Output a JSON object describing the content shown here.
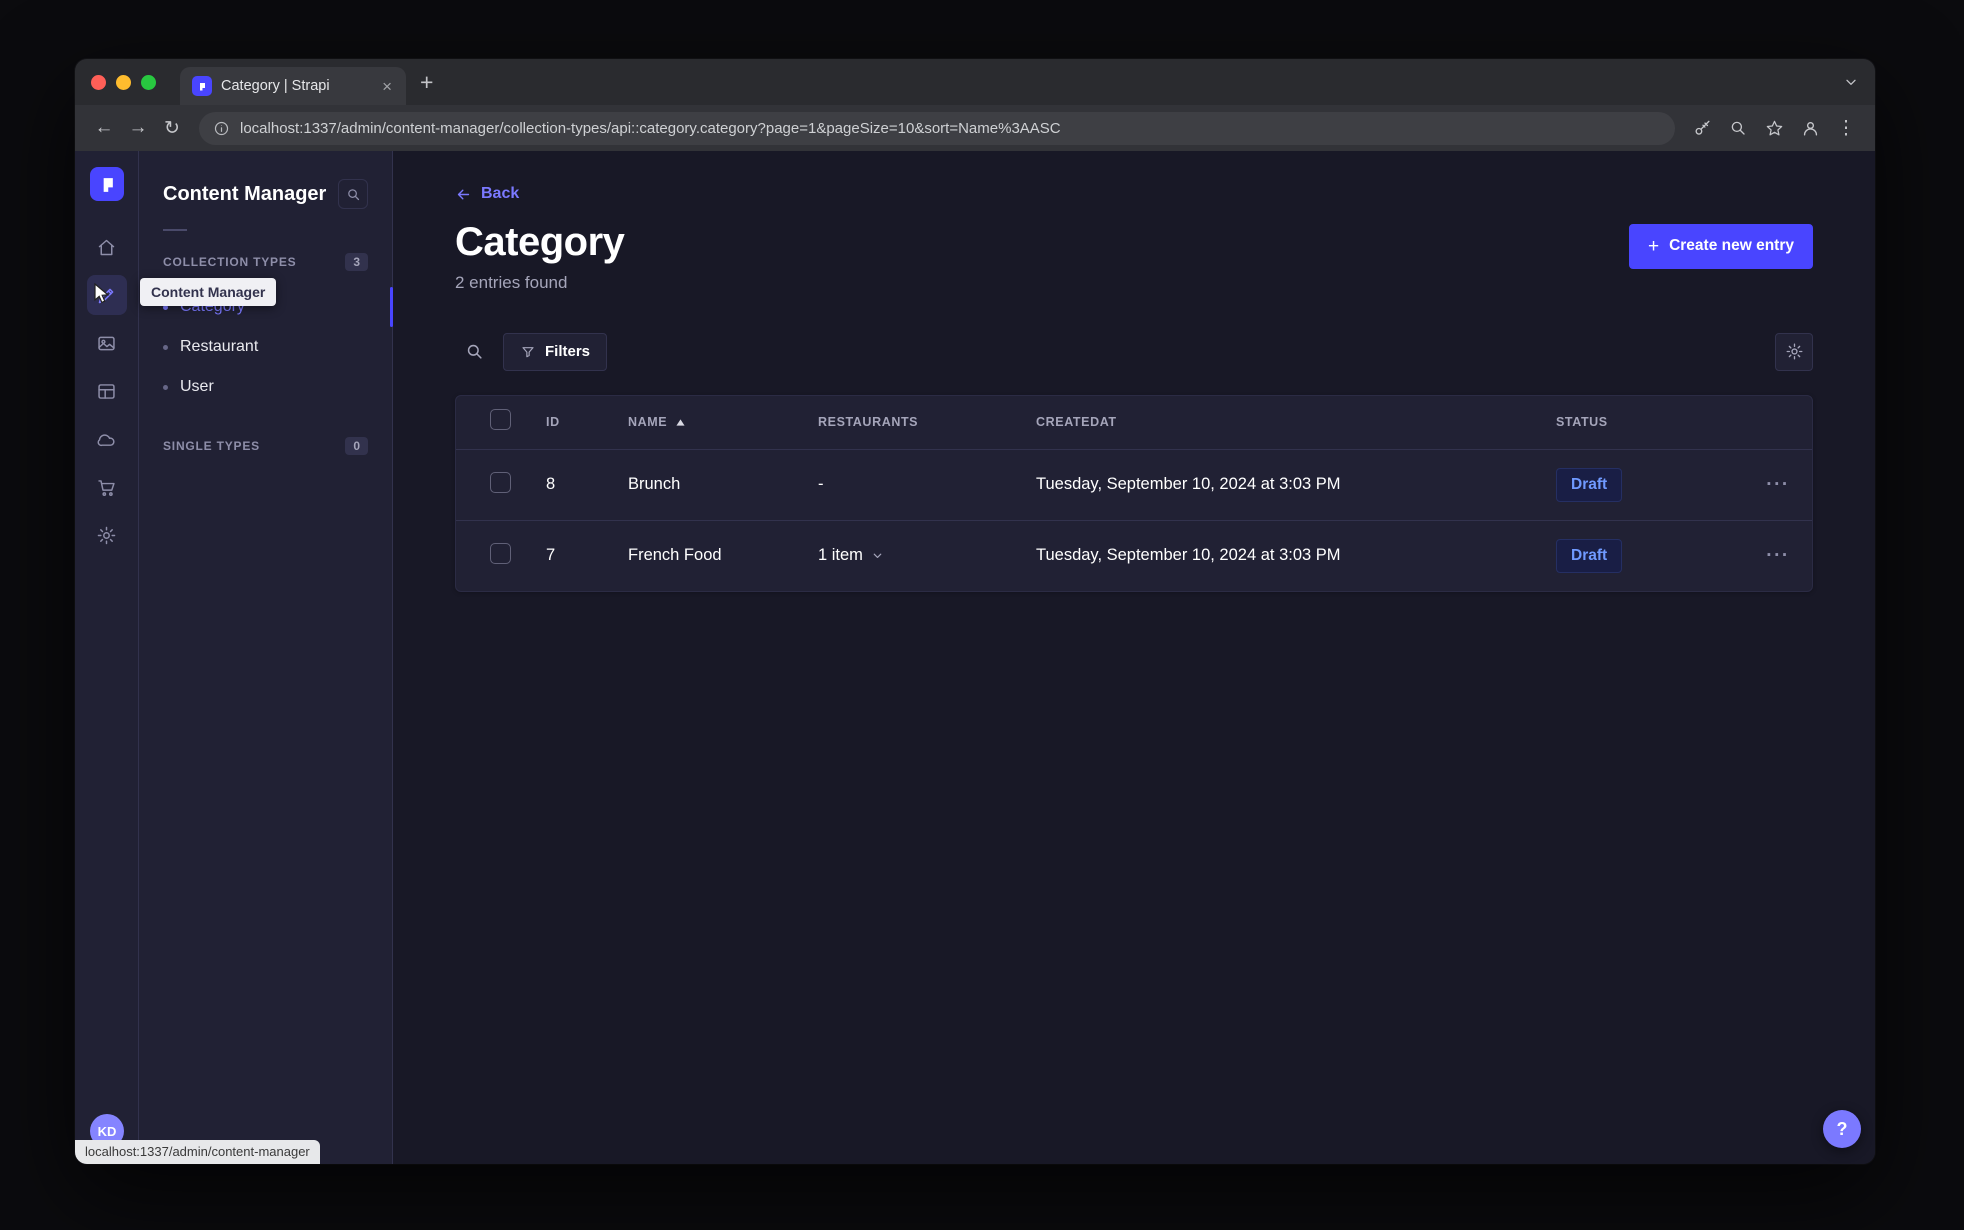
{
  "browser": {
    "tab_title": "Category | Strapi",
    "url": "localhost:1337/admin/content-manager/collection-types/api::category.category?page=1&pageSize=10&sort=Name%3AASC",
    "status_link": "localhost:1337/admin/content-manager"
  },
  "rail": {
    "tooltip": "Content Manager",
    "avatar": "KD"
  },
  "subnav": {
    "title": "Content Manager",
    "collection_section": {
      "label": "COLLECTION TYPES",
      "badge": "3"
    },
    "single_section": {
      "label": "SINGLE TYPES",
      "badge": "0"
    },
    "items": [
      {
        "label": "Category",
        "active": true
      },
      {
        "label": "Restaurant",
        "active": false
      },
      {
        "label": "User",
        "active": false
      }
    ]
  },
  "main": {
    "back": "Back",
    "title": "Category",
    "subtitle": "2 entries found",
    "create_button": "Create new entry",
    "filters": "Filters",
    "help": "?",
    "table": {
      "headers": {
        "id": "ID",
        "name": "NAME",
        "restaurants": "RESTAURANTS",
        "created": "CREATEDAT",
        "status": "STATUS"
      },
      "rows": [
        {
          "id": "8",
          "name": "Brunch",
          "restaurants": "-",
          "created": "Tuesday, September 10, 2024 at 3:03 PM",
          "status": "Draft"
        },
        {
          "id": "7",
          "name": "French Food",
          "restaurants": "1 item",
          "created": "Tuesday, September 10, 2024 at 3:03 PM",
          "status": "Draft"
        }
      ]
    }
  },
  "icons": {
    "close": "×",
    "new_tab": "+",
    "menu": "⋮",
    "back_arrow": "←",
    "forward_arrow": "→",
    "reload": "↻",
    "plus": "+",
    "ellipsis": "···"
  },
  "colors": {
    "primary": "#4945ff",
    "primary_light": "#7b79ff",
    "background": "#181826",
    "panel": "#212134",
    "border": "#32324d",
    "muted_text": "#a5a5ba",
    "draft_text": "#709aff"
  }
}
